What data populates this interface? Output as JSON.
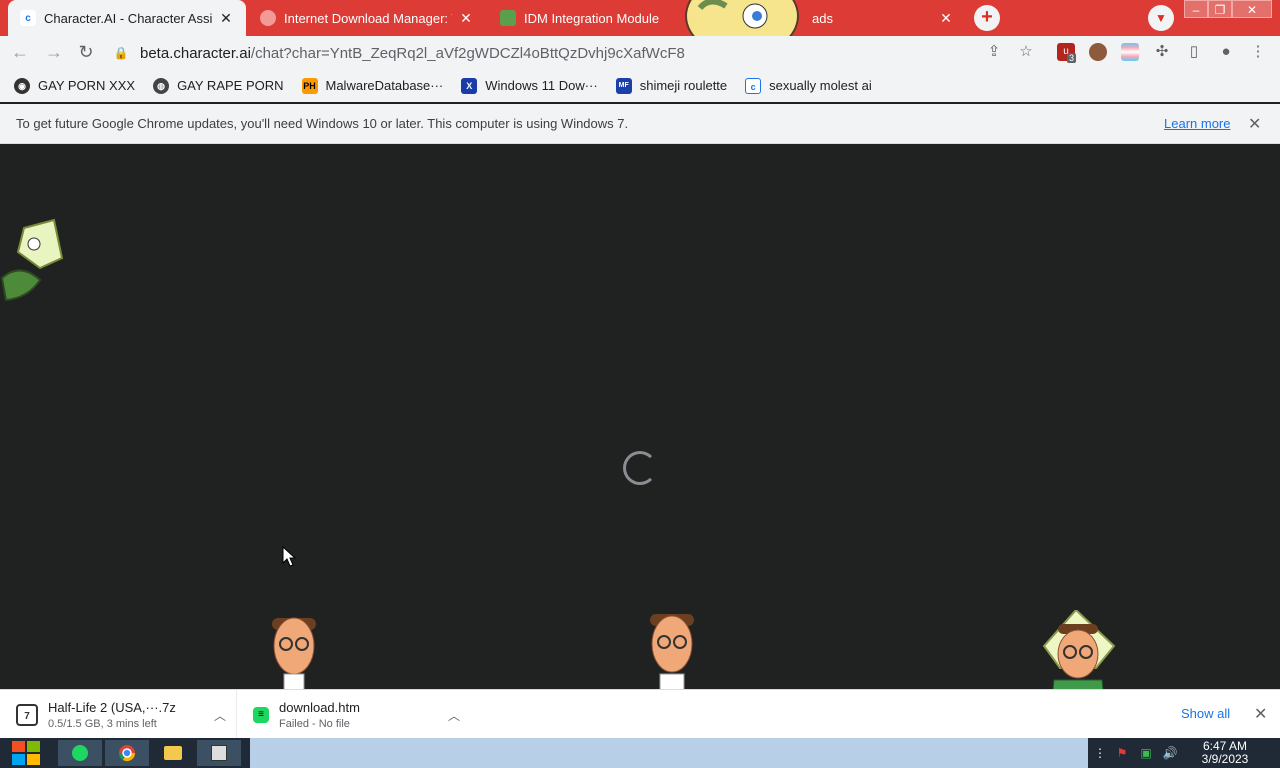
{
  "tabs": [
    {
      "title": "Character.AI - Character Assist",
      "active": true,
      "icon": "character-ai-icon"
    },
    {
      "title": "Internet Download Manager: The",
      "active": false,
      "icon": "idm-icon"
    },
    {
      "title": "IDM Integration Module",
      "active": false,
      "icon": "puzzle-icon"
    },
    {
      "title": "ads",
      "active": false,
      "icon": ""
    }
  ],
  "toolbar": {
    "url_host": "beta.character.ai",
    "url_path": "/chat?char=YntB_ZeqRq2l_aVf2gWDCZl4oBttQzDvhj9cXafWcF8",
    "ext_badge": "3"
  },
  "bookmarks": [
    {
      "label": "GAY PORN XXX",
      "icon": "github-icon"
    },
    {
      "label": "GAY RAPE PORN",
      "icon": "globe-icon"
    },
    {
      "label": "MalwareDatabase···",
      "icon": "ph-icon",
      "icon_text": "PH"
    },
    {
      "label": "Windows 11 Dow···",
      "icon": "x-icon",
      "icon_text": "X"
    },
    {
      "label": "shimeji roulette",
      "icon": "mf-icon",
      "icon_text": "MF"
    },
    {
      "label": "sexually molest ai",
      "icon": "character-ai-icon"
    }
  ],
  "infobar": {
    "message": "To get future Google Chrome updates, you'll need Windows 10 or later. This computer is using Windows 7.",
    "link": "Learn more"
  },
  "downloads": [
    {
      "name": "Half-Life 2 (USA,···.7z",
      "status": "0.5/1.5 GB, 3 mins left",
      "icon": "7zip-icon",
      "icon_text": "7"
    },
    {
      "name": "download.htm",
      "status": "Failed - No file",
      "icon": "spotify-icon"
    }
  ],
  "downloads_bar": {
    "show_all": "Show all"
  },
  "taskbar": {
    "time": "6:47 AM",
    "date": "3/9/2023"
  },
  "colors": {
    "tabstrip": "#dd3b35",
    "page_bg": "#202221",
    "taskbar": "#b7d0e7",
    "link": "#1a73e8"
  }
}
